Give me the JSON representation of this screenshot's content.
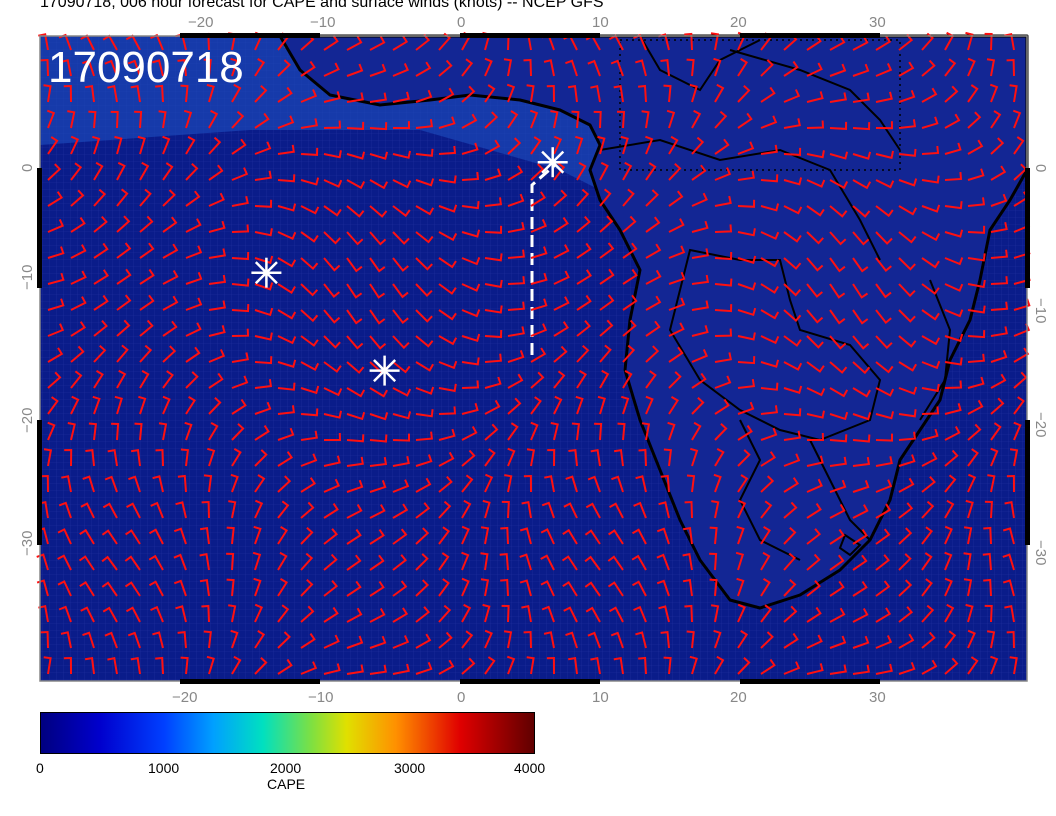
{
  "title": "17090718, 006 hour forecast for CAPE and surface winds (knots) -- NCEP GFS",
  "stamp": "17090718",
  "colors": {
    "ocean": "#0a1c8a",
    "barb": "#ff1010",
    "coast": "#000000",
    "marker": "#ffffff",
    "cape_high": "#20d0c0"
  },
  "axes": {
    "lon_ticks": [
      "−20",
      "−10",
      "0",
      "10",
      "20",
      "30"
    ],
    "lat_ticks": [
      "0",
      "−10",
      "−20",
      "−30"
    ]
  },
  "colorbar": {
    "label": "CAPE",
    "ticks": [
      "0",
      "1000",
      "2000",
      "3000",
      "4000"
    ]
  },
  "markers": [
    {
      "lon": -14,
      "lat": -8.5
    },
    {
      "lon": -5.5,
      "lat": -16.3
    },
    {
      "lon": 6.6,
      "lat": 0.3
    }
  ]
}
